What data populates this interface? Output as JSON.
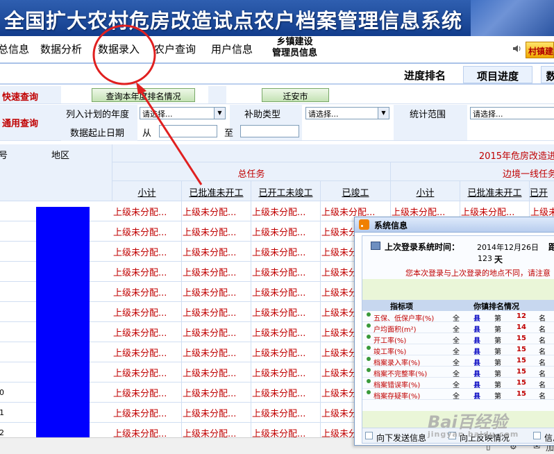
{
  "app": {
    "title": "全国扩大农村危房改造试点农户档案管理信息系统"
  },
  "menu": {
    "items": [
      "总信息",
      "数据分析",
      "数据录入",
      "农户查询",
      "用户信息"
    ],
    "township_line1": "乡镇建设",
    "township_line2": "管理员信息",
    "village_button": "村镇建"
  },
  "tabs": [
    "进度排名",
    "项目进度",
    "数"
  ],
  "quick_query": {
    "label": "快速查询",
    "rank_button": "查询本年度排名情况",
    "city_button": "迁安市"
  },
  "general_query": {
    "label": "通用查询",
    "year_label": "列入计划的年度",
    "year_value": "请选择...",
    "subsidy_label": "补助类型",
    "subsidy_value": "请选择...",
    "scope_label": "统计范围",
    "scope_value": "请选择...",
    "date_label": "数据起止日期",
    "from_label": "从",
    "to_label": "至"
  },
  "grid": {
    "col_no": "号",
    "col_region": "地区",
    "year_title": "2015年危房改造进",
    "group_total": "总任务",
    "group_border": "边境一线任务",
    "sub_headers": [
      "小计",
      "已批准未开工",
      "已开工未竣工",
      "已竣工",
      "小计",
      "已批准未开工",
      "已开"
    ],
    "cell_text": "上级未分配...",
    "row_numbers": [
      "",
      "",
      "",
      "",
      "",
      "",
      "",
      "",
      "",
      "0",
      "1",
      "2"
    ]
  },
  "popup": {
    "title": "系统信息",
    "last_login_label": "上次登录系统时间：",
    "last_login_date": "2014年12月26日",
    "distance_label": "距上",
    "days_value": "123",
    "days_unit": "天",
    "location_warning": "您本次登录与上次登录的地点不同，请注意",
    "table_header_indicator": "指标项",
    "table_header_rank": "你镇排名情况",
    "rank_rows": [
      {
        "name": "五保、低保户率(%)",
        "all": "全",
        "county": "县",
        "di": "第",
        "rank": "12",
        "ming": "名"
      },
      {
        "name": "户均面积(m²)",
        "all": "全",
        "county": "县",
        "di": "第",
        "rank": "14",
        "ming": "名"
      },
      {
        "name": "开工率(%)",
        "all": "全",
        "county": "县",
        "di": "第",
        "rank": "15",
        "ming": "名"
      },
      {
        "name": "竣工率(%)",
        "all": "全",
        "county": "县",
        "di": "第",
        "rank": "15",
        "ming": "名"
      },
      {
        "name": "档案录入率(%)",
        "all": "全",
        "county": "县",
        "di": "第",
        "rank": "15",
        "ming": "名"
      },
      {
        "name": "档案不完整率(%)",
        "all": "全",
        "county": "县",
        "di": "第",
        "rank": "15",
        "ming": "名"
      },
      {
        "name": "档案错误率(%)",
        "all": "全",
        "county": "县",
        "di": "第",
        "rank": "15",
        "ming": "名"
      },
      {
        "name": "档案存疑率(%)",
        "all": "全",
        "county": "县",
        "di": "第",
        "rank": "15",
        "ming": "名"
      }
    ],
    "bottom_left": "向下发送信息",
    "bottom_mid": "向上反映情况",
    "bottom_right": "信息"
  },
  "watermark": {
    "main": "Bai百经验",
    "sub": "jingyan.baidu.com"
  },
  "statusbar": {
    "right_text": "加"
  },
  "colors": {
    "banner": "#1f4d9e",
    "alert_red": "#c00000",
    "header_bg": "#eaf1fb",
    "blue_bar": "#0000ff",
    "annotation_red": "#e02020"
  },
  "icons": [
    "speaker-icon",
    "rss-icon",
    "login-computer-icon",
    "dropdown-arrow-icon",
    "phone-icon",
    "gear-icon",
    "chat-icon"
  ]
}
